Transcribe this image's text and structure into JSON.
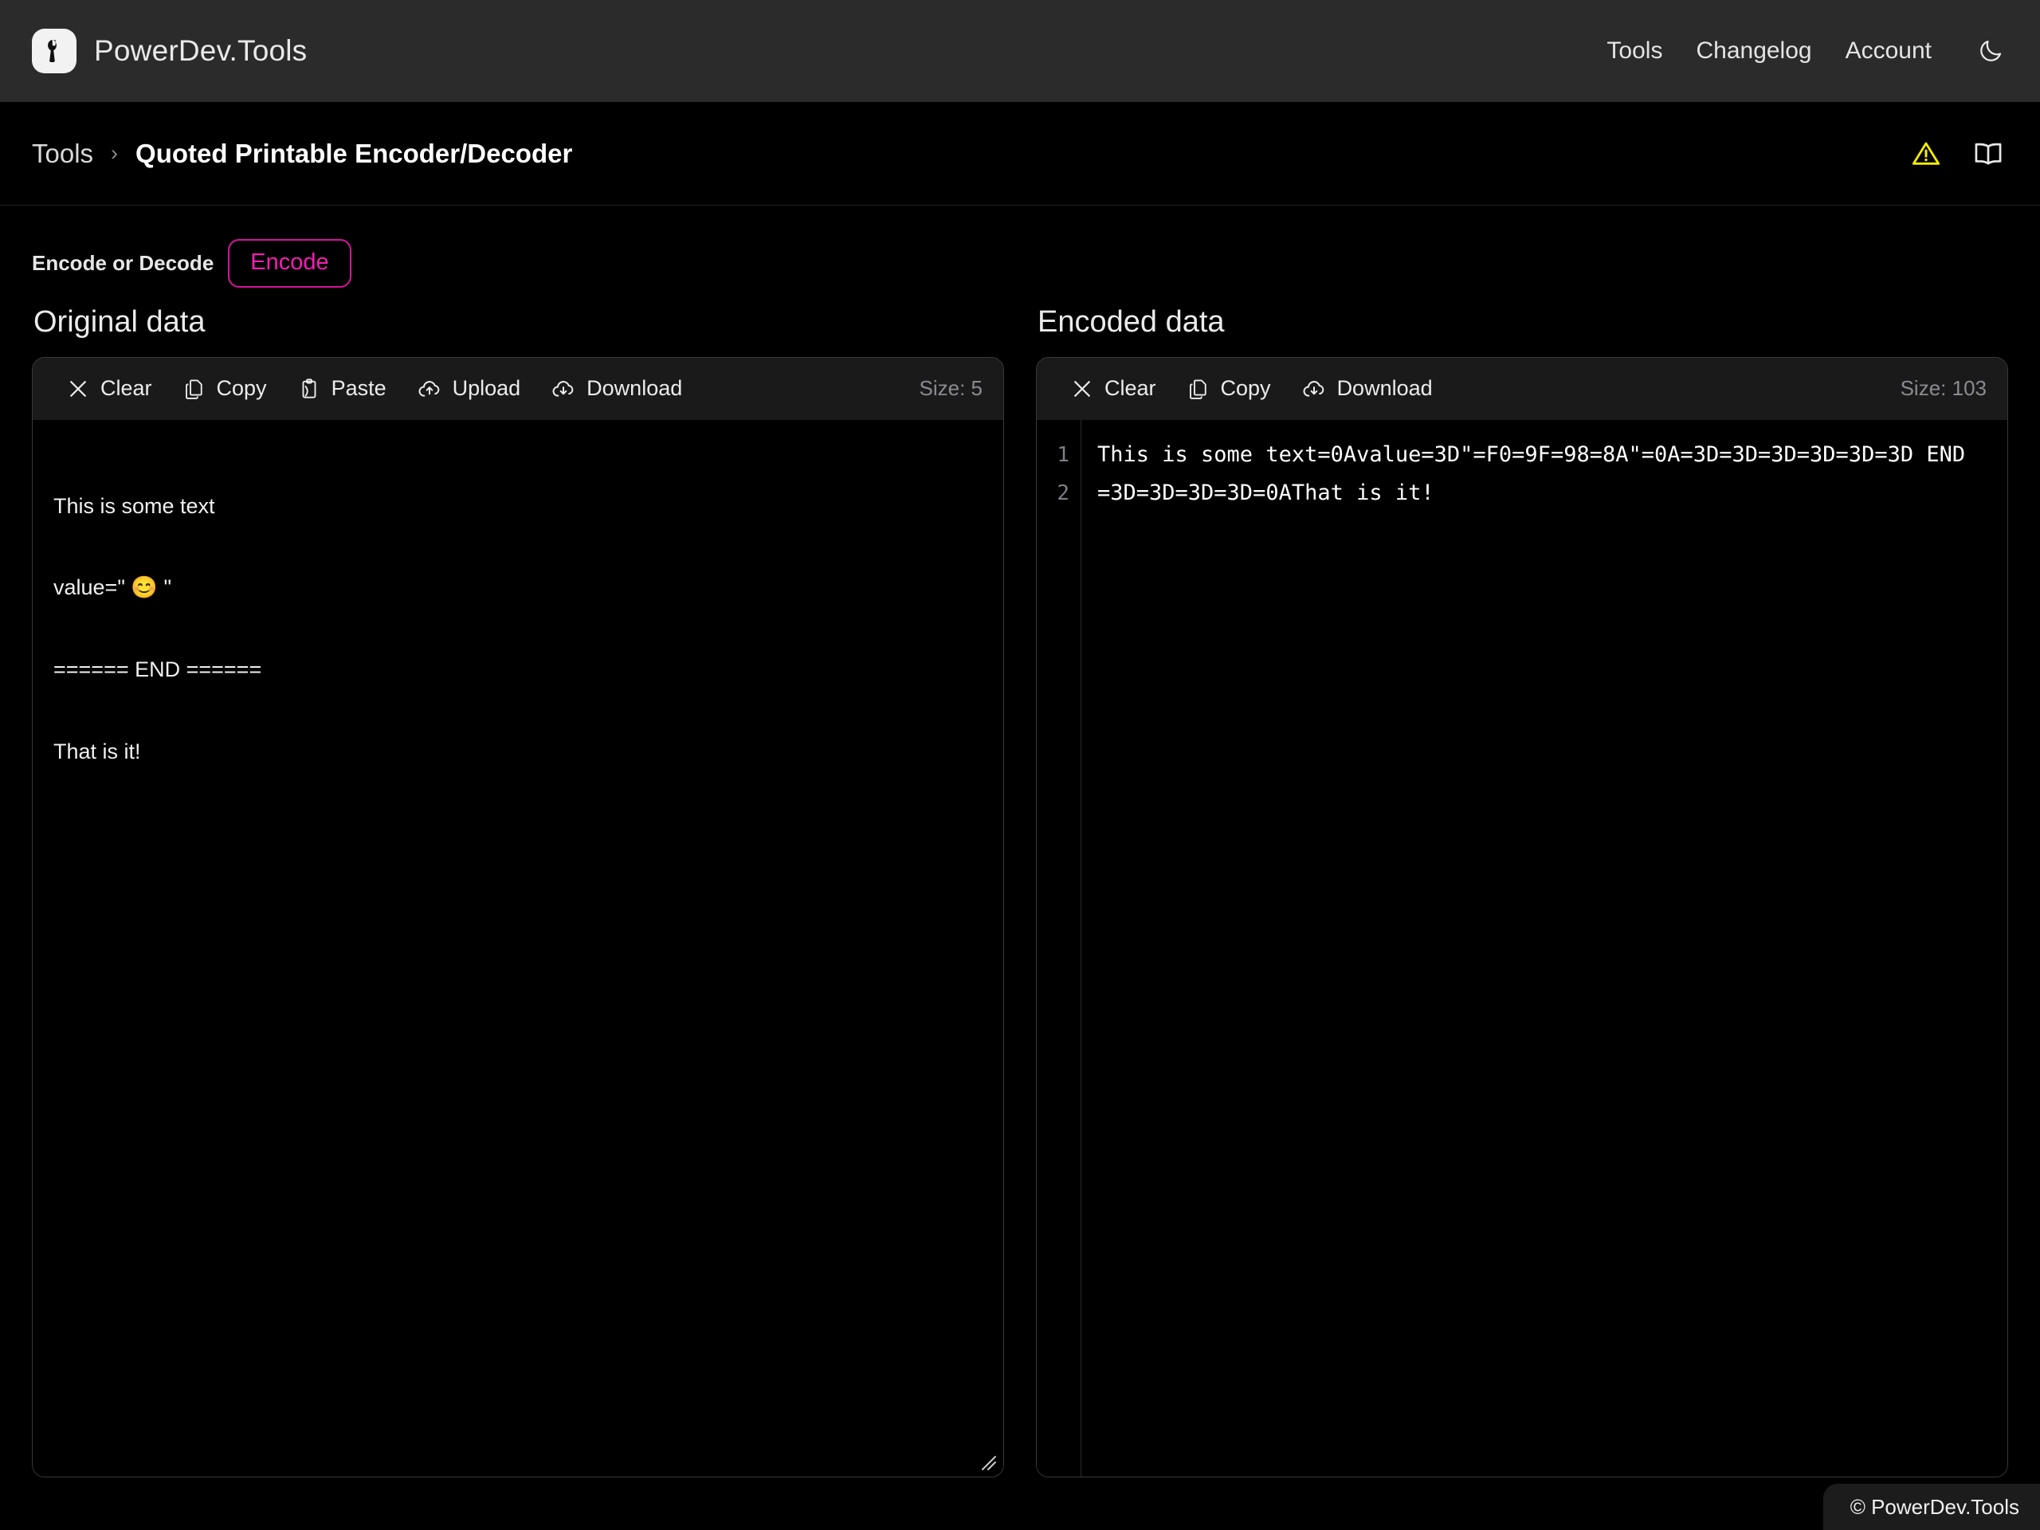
{
  "header": {
    "brand_name": "PowerDev.Tools",
    "logo_icon": "wrench-icon",
    "nav": [
      {
        "label": "Tools"
      },
      {
        "label": "Changelog"
      },
      {
        "label": "Account"
      }
    ],
    "theme_toggle_icon": "moon-icon"
  },
  "breadcrumb": {
    "parent": "Tools",
    "separator": "›",
    "current": "Quoted Printable Encoder/Decoder",
    "actions": [
      {
        "name": "warning-icon",
        "color": "#f5ec00"
      },
      {
        "name": "book-icon",
        "color": "#e8e8e8"
      }
    ]
  },
  "mode": {
    "label": "Encode or Decode",
    "button_label": "Encode",
    "accent_color": "#f21fb2",
    "border_color": "#d6129a"
  },
  "left_panel": {
    "title": "Original data",
    "toolbar": [
      {
        "label": "Clear",
        "icon": "close-icon"
      },
      {
        "label": "Copy",
        "icon": "copy-icon"
      },
      {
        "label": "Paste",
        "icon": "paste-icon"
      },
      {
        "label": "Upload",
        "icon": "cloud-upload-icon"
      },
      {
        "label": "Download",
        "icon": "cloud-download-icon"
      }
    ],
    "size_label": "Size: 5",
    "content_lines": [
      "This is some text",
      "value=\" 😊 \"",
      "====== END ======",
      "That is it!"
    ]
  },
  "right_panel": {
    "title": "Encoded data",
    "toolbar": [
      {
        "label": "Clear",
        "icon": "close-icon"
      },
      {
        "label": "Copy",
        "icon": "copy-icon"
      },
      {
        "label": "Download",
        "icon": "cloud-download-icon"
      }
    ],
    "size_label": "Size: 103",
    "line_numbers": [
      "1",
      "2"
    ],
    "code_lines": [
      "This is some text=0Avalue=3D\"=F0=9F=98=8A\"=0A=3D=3D=3D=3D=3D=3D END",
      "=3D=3D=3D=3D=0AThat is it!"
    ]
  },
  "footer": {
    "text": "© PowerDev.Tools"
  }
}
